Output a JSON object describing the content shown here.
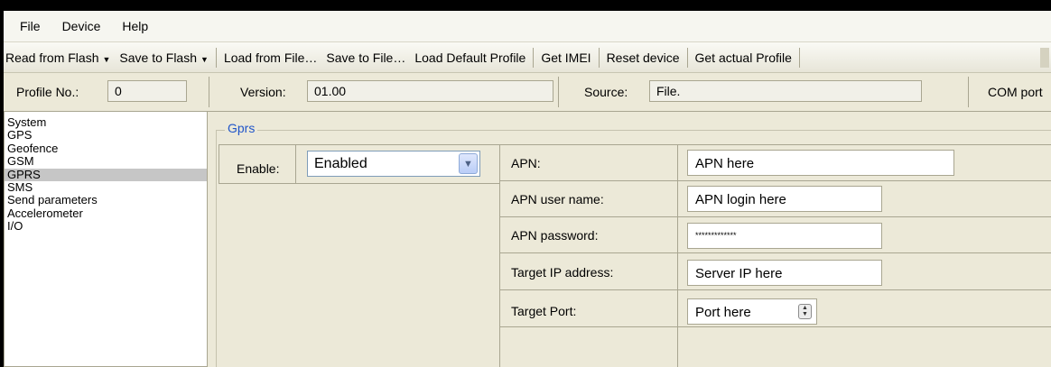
{
  "menu": [
    "File",
    "Device",
    "Help"
  ],
  "toolbar": {
    "read_from_flash": "Read from Flash",
    "save_to_flash": "Save to Flash",
    "load_from_file": "Load from File…",
    "save_to_file": "Save to File…",
    "load_default_profile": "Load Default Profile",
    "get_imei": "Get IMEI",
    "reset_device": "Reset device",
    "get_actual_profile": "Get actual Profile"
  },
  "info": {
    "profile_label": "Profile No.:",
    "profile_value": "0",
    "version_label": "Version:",
    "version_value": "01.00",
    "source_label": "Source:",
    "source_value": "File.",
    "com_port_label": "COM port"
  },
  "nav": {
    "items": [
      "System",
      "GPS",
      "Geofence",
      "GSM",
      "GPRS",
      "SMS",
      "Send parameters",
      "Accelerometer",
      "I/O"
    ],
    "selected": "GPRS"
  },
  "gprs": {
    "group_title": "Gprs",
    "enable_label": "Enable:",
    "enable_value": "Enabled",
    "apn_label": "APN:",
    "apn_value": "APN here",
    "apn_user_label": "APN user name:",
    "apn_user_value": "APN login here",
    "apn_password_label": "APN password:",
    "apn_password_value": "*************",
    "target_ip_label": "Target IP address:",
    "target_ip_value": "Server IP here",
    "target_port_label": "Target Port:",
    "target_port_value": "Port here"
  }
}
